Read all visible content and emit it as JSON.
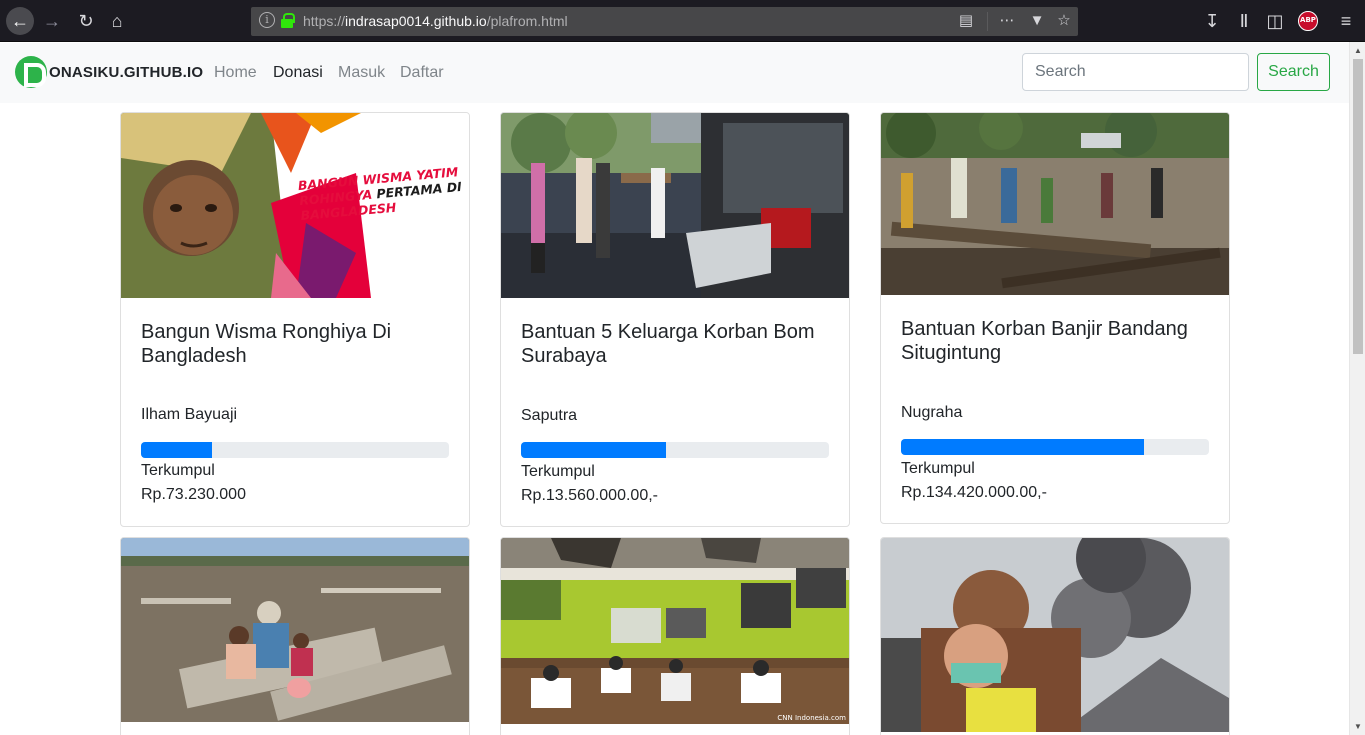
{
  "browser": {
    "url_prefix": "https://",
    "url_host": "indrasap0014.github.io",
    "url_path": "/plafrom.html",
    "abp_label": "ABP"
  },
  "navbar": {
    "brand": "ONASIKU.GITHUB.IO",
    "links": [
      "Home",
      "Donasi",
      "Masuk",
      "Daftar"
    ],
    "active_link": "Donasi",
    "search_placeholder": "Search",
    "search_button": "Search"
  },
  "cards": [
    {
      "title": "Bangun Wisma Ronghiya Di Bangladesh",
      "organizer": "Ilham Bayuaji",
      "raised_label": "Terkumpul",
      "amount": "Rp.73.230.000",
      "progress": 0.23,
      "image_text": [
        "BANGUN WISMA YATIM",
        "ROHINGYA",
        "PERTAMA DI",
        "BANGLADESH"
      ]
    },
    {
      "title": "Bantuan 5 Keluarga Korban Bom Surabaya",
      "organizer": "Saputra",
      "raised_label": "Terkumpul",
      "amount": "Rp.13.560.000.00,-",
      "progress": 0.47
    },
    {
      "title": "Bantuan Korban Banjir Bandang Situgintung",
      "organizer": "Nugraha",
      "raised_label": "Terkumpul",
      "amount": "Rp.134.420.000.00,-",
      "progress": 0.79
    },
    {
      "image_only": true
    },
    {
      "image_only": true,
      "image_caption": "CNN Indonesia.com"
    },
    {
      "image_only": true
    }
  ]
}
